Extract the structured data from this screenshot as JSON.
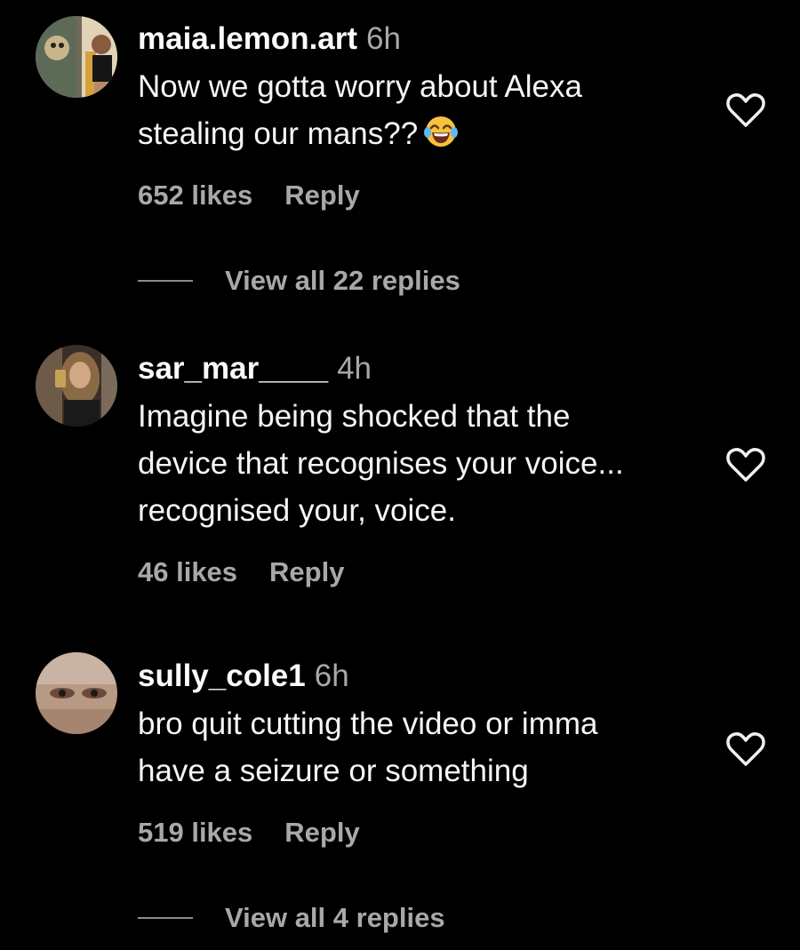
{
  "comments": [
    {
      "username": "maia.lemon.art",
      "time": "6h",
      "text_lines": [
        "Now we gotta worry about Alexa",
        "stealing our mans??"
      ],
      "emoji": "face-with-tears-of-joy",
      "likes": "652 likes",
      "reply_label": "Reply",
      "view_replies": "View all 22 replies"
    },
    {
      "username": "sar_mar____",
      "time": "4h",
      "text_lines": [
        "Imagine being shocked that the",
        "device that recognises your voice...",
        "recognised your, voice."
      ],
      "likes": "46 likes",
      "reply_label": "Reply"
    },
    {
      "username": "sully_cole1",
      "time": "6h",
      "text_lines": [
        "bro quit cutting the video or imma",
        "have a seizure or something"
      ],
      "likes": "519 likes",
      "reply_label": "Reply",
      "view_replies": "View all 4 replies"
    }
  ],
  "colors": {
    "background": "#000000",
    "primary_text": "#f5f5f5",
    "secondary_text": "#a8a8a8"
  }
}
